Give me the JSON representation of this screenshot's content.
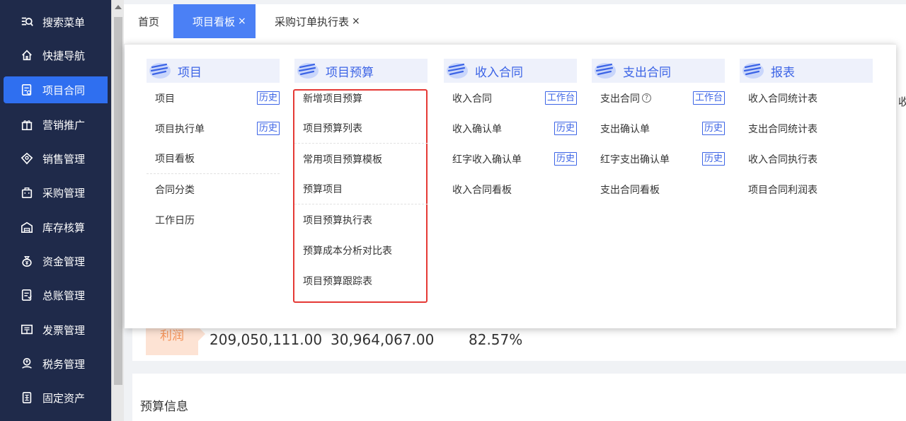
{
  "sidebar": {
    "items": [
      {
        "label": "搜索菜单",
        "icon": "search-menu-icon"
      },
      {
        "label": "快捷导航",
        "icon": "home-icon"
      },
      {
        "label": "项目合同",
        "icon": "contract-icon"
      },
      {
        "label": "营销推广",
        "icon": "gift-icon"
      },
      {
        "label": "销售管理",
        "icon": "sales-icon"
      },
      {
        "label": "采购管理",
        "icon": "bag-icon"
      },
      {
        "label": "库存核算",
        "icon": "warehouse-icon"
      },
      {
        "label": "资金管理",
        "icon": "money-bag-icon"
      },
      {
        "label": "总账管理",
        "icon": "ledger-icon"
      },
      {
        "label": "发票管理",
        "icon": "invoice-icon"
      },
      {
        "label": "税务管理",
        "icon": "tax-icon"
      },
      {
        "label": "固定资产",
        "icon": "asset-icon"
      }
    ],
    "active_index": 2
  },
  "tabs": [
    {
      "label": "首页"
    },
    {
      "label": "项目看板",
      "close": "×"
    },
    {
      "label": "采购订单执行表",
      "close": "×"
    }
  ],
  "background": {
    "edge_text": "收",
    "profit_label": "利润",
    "num1": "209,050,111.00",
    "num2": "30,964,067.00",
    "percent": "82.57%",
    "budget_title": "预算信息"
  },
  "menu": {
    "columns": [
      {
        "title": "项目",
        "icon": "project-icon",
        "items": [
          {
            "label": "项目",
            "tag": "历史"
          },
          {
            "label": "项目执行单",
            "tag": "历史"
          },
          {
            "label": "项目看板",
            "sep": true
          },
          {
            "label": "合同分类"
          },
          {
            "label": "工作日历"
          }
        ]
      },
      {
        "title": "项目预算",
        "icon": "budget-icon",
        "items": [
          {
            "label": "新增项目预算"
          },
          {
            "label": "项目预算列表",
            "sep": true
          },
          {
            "label": "常用项目预算模板"
          },
          {
            "label": "预算项目",
            "sep": true
          },
          {
            "label": "项目预算执行表"
          },
          {
            "label": "预算成本分析对比表"
          },
          {
            "label": "项目预算跟踪表"
          }
        ]
      },
      {
        "title": "收入合同",
        "icon": "income-contract-icon",
        "items": [
          {
            "label": "收入合同",
            "tag": "工作台"
          },
          {
            "label": "收入确认单",
            "tag": "历史"
          },
          {
            "label": "红字收入确认单",
            "tag": "历史"
          },
          {
            "label": "收入合同看板"
          }
        ]
      },
      {
        "title": "支出合同",
        "icon": "expense-contract-icon",
        "items": [
          {
            "label": "支出合同",
            "tag": "工作台",
            "help": "?"
          },
          {
            "label": "支出确认单",
            "tag": "历史"
          },
          {
            "label": "红字支出确认单",
            "tag": "历史"
          },
          {
            "label": "支出合同看板"
          }
        ]
      },
      {
        "title": "报表",
        "icon": "report-icon",
        "items": [
          {
            "label": "收入合同统计表"
          },
          {
            "label": "支出合同统计表"
          },
          {
            "label": "收入合同执行表"
          },
          {
            "label": "项目合同利润表"
          }
        ]
      }
    ]
  },
  "colors": {
    "sidebar_bg": "#1f2a4a",
    "active_blue": "#2f6ff0",
    "tab_active": "#4b80f5",
    "menu_blue": "#3c64e6",
    "highlight_red": "#e53935"
  }
}
